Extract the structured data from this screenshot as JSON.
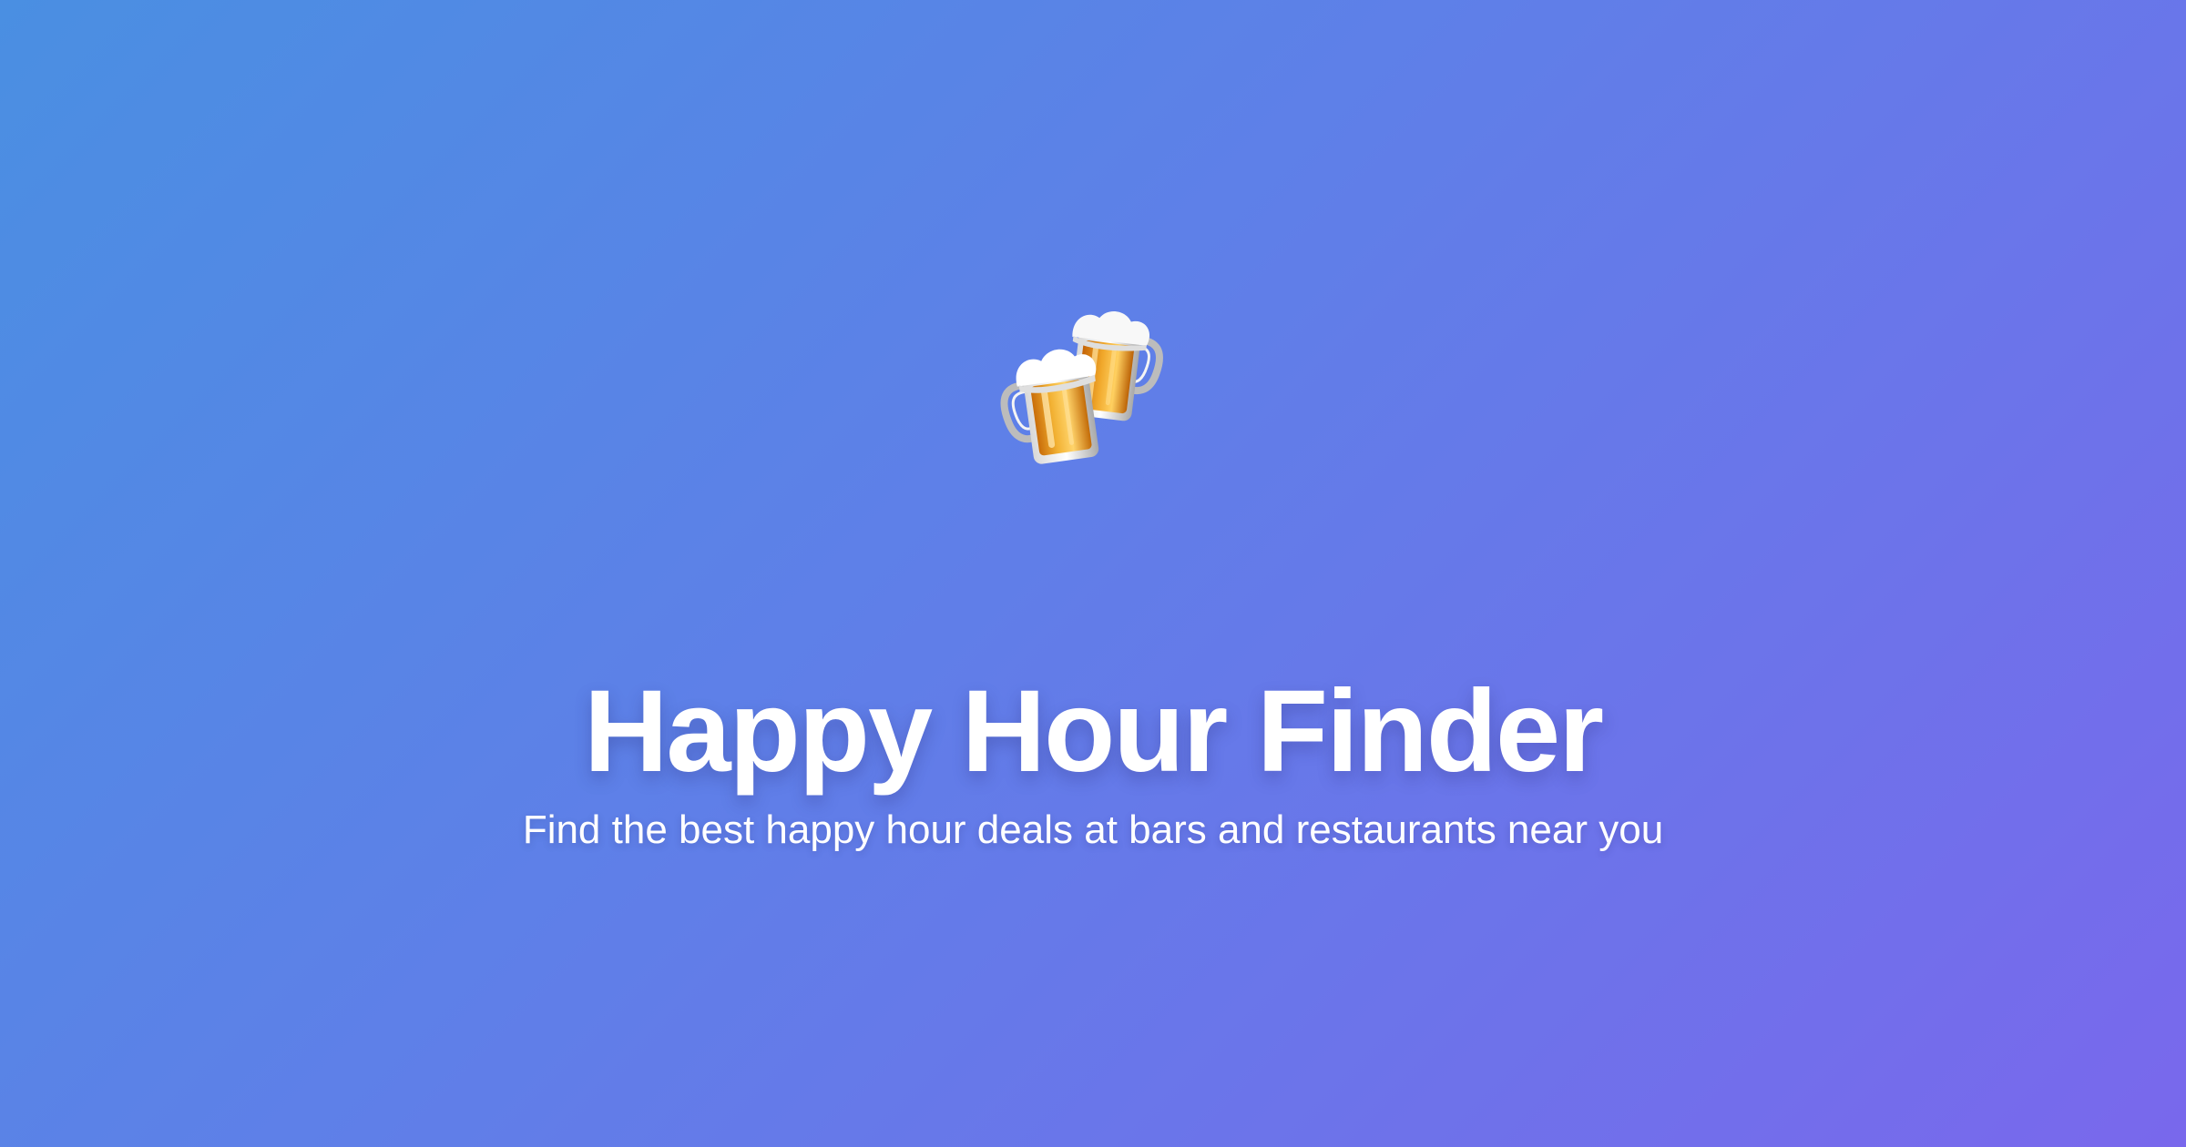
{
  "hero": {
    "icon_name": "clinking-beer-mugs-icon",
    "title": "Happy Hour Finder",
    "subtitle": "Find the best happy hour deals at bars and restaurants near you"
  },
  "colors": {
    "background_gradient_start": "#4a8fe2",
    "background_gradient_end": "#7968ec",
    "text": "#ffffff",
    "beer": "#e99b1a",
    "foam": "#ffffff"
  }
}
